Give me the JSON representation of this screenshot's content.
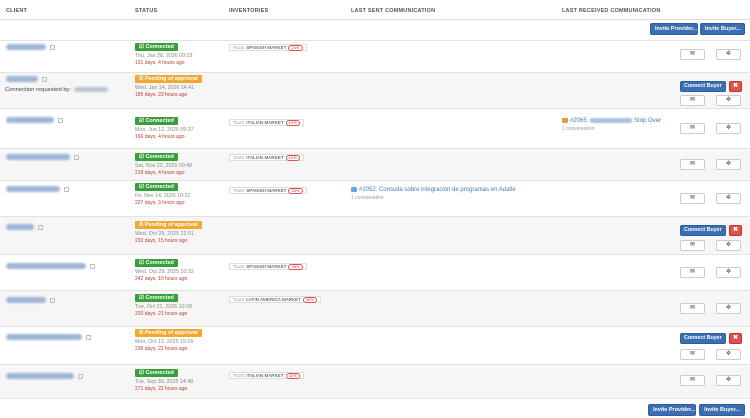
{
  "columns": {
    "client": "CLIENT",
    "status": "STATUS",
    "inventories": "INVENTORIES",
    "last_sent": "LAST SENT COMMUNICATION",
    "last_received": "LAST RECEIVED COMMUNICATION"
  },
  "actions": {
    "invite_provider": "Invite Provider...",
    "invite_buyer": "Invite Buyer...",
    "connect_buyer": "Connect Buyer",
    "reject": "✖",
    "mail_icon": "✉",
    "gear_icon": "✲"
  },
  "colors": {
    "primary": "#3c6eb4",
    "connected": "#3a9e3a",
    "pending": "#f0a830",
    "danger": "#d9534f",
    "link": "#3c7fc0"
  },
  "rows": [
    {
      "status": "☑ Connected",
      "date": "Thu, Jan 28, 2026 09:19",
      "ago": "131 days, 4 hours ago",
      "inventory_label": "Tours",
      "inventory": "SPANISH MARKET",
      "inventory_pct": "24%"
    },
    {
      "status": "⏱ Pending of approval",
      "requested_by": "Connection requested by:",
      "date": "Wed, Jan 14, 2026 14:41",
      "ago": "185 days, 23 hours ago"
    },
    {
      "status": "☑ Connected",
      "date": "Mon, Jun 12, 2026 09:37",
      "ago": "166 days, 4 hours ago",
      "inventory_label": "Tours",
      "inventory": "ITALIAN MARKET",
      "inventory_pct": "19%",
      "received_title": "#2065:",
      "received_suffix": "Stop Over",
      "received_sub": "1 conversation"
    },
    {
      "status": "☑ Connected",
      "date": "Sat, Nov 22, 2025 09:40",
      "ago": "219 days, 4 hours ago",
      "inventory_label": "Tours",
      "inventory": "ITALIAN MARKET",
      "inventory_pct": "10%"
    },
    {
      "status": "☑ Connected",
      "date": "Fri, Nov 14, 2025 10:22",
      "ago": "227 days, 3 hours ago",
      "inventory_label": "Tours",
      "inventory": "SPANISH MARKET",
      "inventory_pct": "20%",
      "sent_title": "#2052: Consulta sobre integración de programas en Adalte",
      "sent_sub": "1 conversation"
    },
    {
      "status": "⏱ Pending of approval",
      "date": "Wed, Oct 29, 2025 22:01",
      "ago": "233 days, 15 hours ago"
    },
    {
      "status": "☑ Connected",
      "date": "Wed, Oct 29, 2025 10:32",
      "ago": "242 days, 10 hours ago",
      "inventory_label": "Tours",
      "inventory": "SPANISH MARKET",
      "inventory_pct": "48%"
    },
    {
      "status": "☑ Connected",
      "date": "Tue, Oct 21, 2025 10:28",
      "ago": "220 days, 21 hours ago",
      "inventory_label": "Tours",
      "inventory": "LATIN AMERICA MARKET",
      "inventory_pct": "36%"
    },
    {
      "status": "⏱ Pending of approval",
      "date": "Mon, Oct 13, 2025 15:16",
      "ago": "236 days, 22 hours ago"
    },
    {
      "status": "☑ Connected",
      "date": "Tue, Sep 30, 2025 14:48",
      "ago": "271 days, 22 hours ago",
      "inventory_label": "Tours",
      "inventory": "ITALIAN MARKET",
      "inventory_pct": "32%"
    }
  ]
}
